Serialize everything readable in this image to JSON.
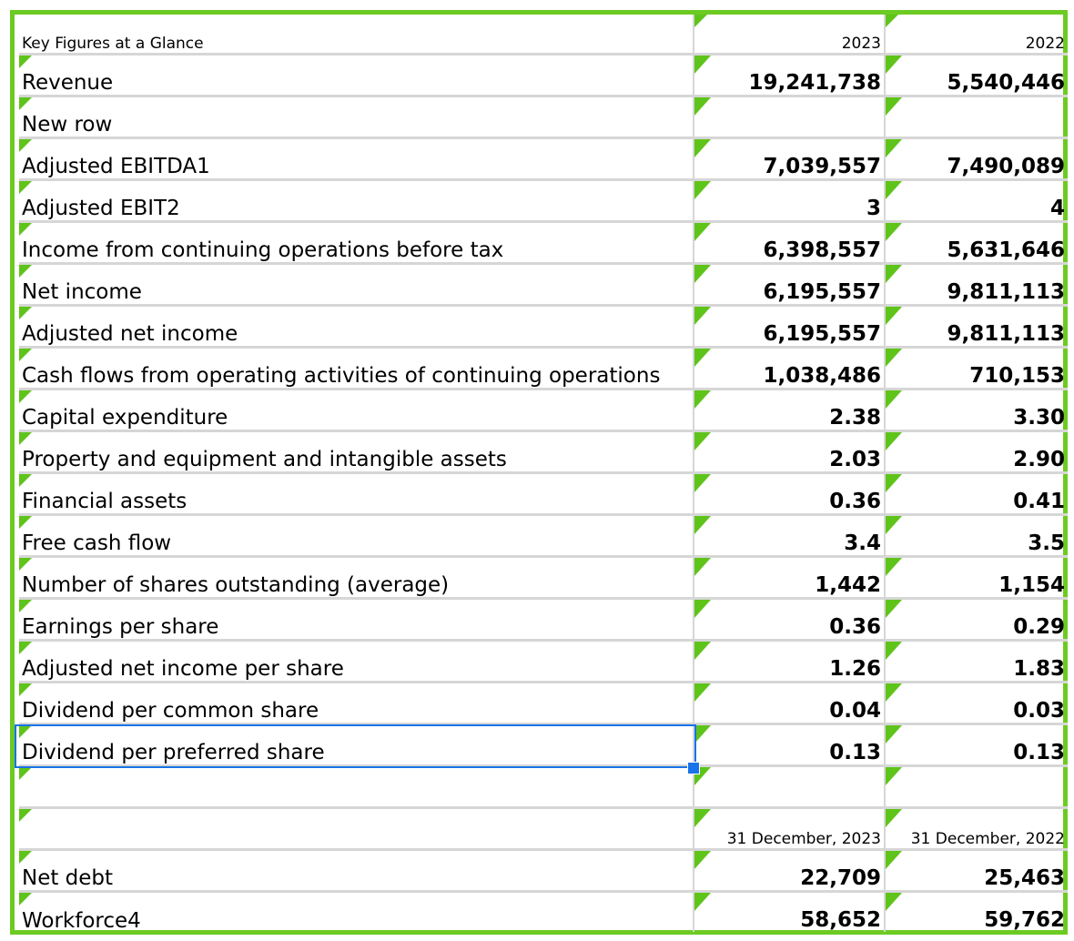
{
  "sheet": {
    "header": {
      "title": "Key Figures at a Glance",
      "col1": "2023",
      "col2": "2022"
    },
    "rows": [
      {
        "label": "Revenue",
        "v1": "19,241,738",
        "v2": "5,540,446"
      },
      {
        "label": "New row",
        "v1": "",
        "v2": ""
      },
      {
        "label": "Adjusted EBITDA1",
        "v1": "7,039,557",
        "v2": "7,490,089"
      },
      {
        "label": "Adjusted EBIT2",
        "v1": "3",
        "v2": "4"
      },
      {
        "label": "Income from continuing operations before tax",
        "v1": "6,398,557",
        "v2": "5,631,646"
      },
      {
        "label": "Net income",
        "v1": "6,195,557",
        "v2": "9,811,113"
      },
      {
        "label": "Adjusted net income",
        "v1": "6,195,557",
        "v2": "9,811,113"
      },
      {
        "label": "Cash flows from operating activities of continuing operations",
        "v1": "1,038,486",
        "v2": "710,153"
      },
      {
        "label": "Capital expenditure",
        "v1": "2.38",
        "v2": "3.30"
      },
      {
        "label": "Property and equipment and intangible assets",
        "v1": "2.03",
        "v2": "2.90"
      },
      {
        "label": "Financial assets",
        "v1": "0.36",
        "v2": "0.41"
      },
      {
        "label": "Free cash flow",
        "v1": "3.4",
        "v2": "3.5"
      },
      {
        "label": "Number of shares outstanding (average)",
        "v1": "1,442",
        "v2": "1,154"
      },
      {
        "label": "Earnings per share",
        "v1": "0.36",
        "v2": "0.29"
      },
      {
        "label": "Adjusted net income per share",
        "v1": "1.26",
        "v2": "1.83"
      },
      {
        "label": "Dividend per common share",
        "v1": "0.04",
        "v2": "0.03"
      },
      {
        "label": "Dividend per preferred share",
        "v1": "0.13",
        "v2": "0.13"
      }
    ],
    "subheader": {
      "col1": "31 December, 2023",
      "col2": "31 December, 2022"
    },
    "rows2": [
      {
        "label": "Net debt",
        "v1": "22,709",
        "v2": "25,463"
      },
      {
        "label": "Workforce4",
        "v1": "58,652",
        "v2": "59,762"
      }
    ]
  },
  "colors": {
    "frame": "#6ccb22",
    "marker": "#5fc41a",
    "selection": "#1a73e8",
    "gridline": "#d6d6d6"
  }
}
